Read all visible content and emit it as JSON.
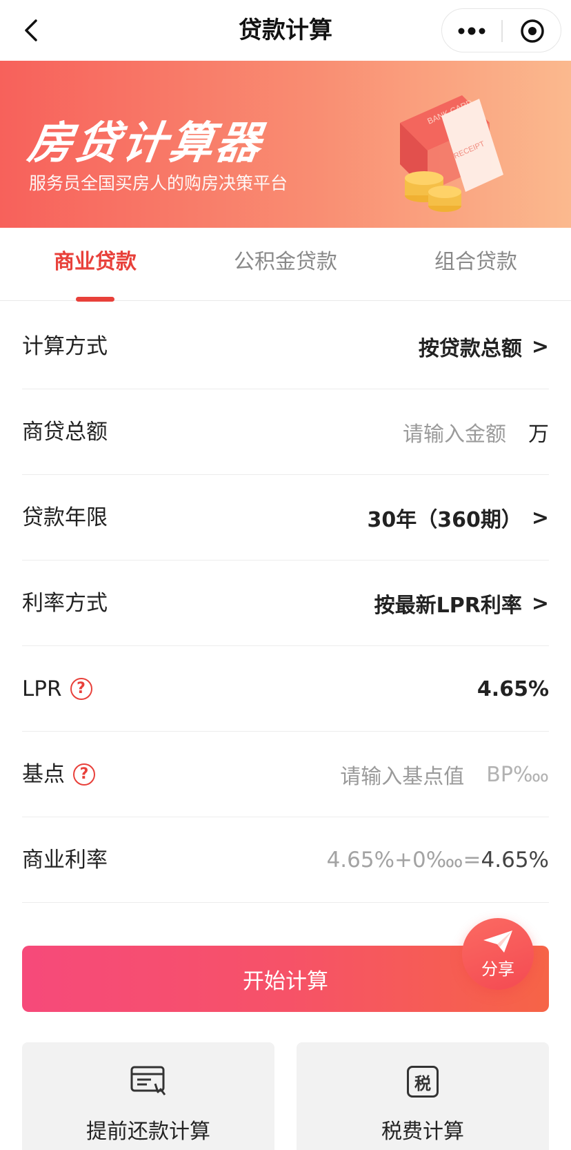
{
  "nav": {
    "title": "贷款计算"
  },
  "banner": {
    "title": "房贷计算器",
    "subtitle": "服务员全国买房人的购房决策平台",
    "illus_card_text": "BANK CARD",
    "illus_receipt_text": "RECEIPT"
  },
  "tabs": [
    {
      "label": "商业贷款",
      "active": true
    },
    {
      "label": "公积金贷款",
      "active": false
    },
    {
      "label": "组合贷款",
      "active": false
    }
  ],
  "form": {
    "calc_method": {
      "label": "计算方式",
      "value": "按贷款总额"
    },
    "loan_amount": {
      "label": "商贷总额",
      "placeholder": "请输入金额",
      "unit": "万"
    },
    "loan_term": {
      "label": "贷款年限",
      "value": "30年（360期）"
    },
    "rate_method": {
      "label": "利率方式",
      "value": "按最新LPR利率"
    },
    "lpr": {
      "label": "LPR",
      "help": "?",
      "value": "4.65%"
    },
    "basis_point": {
      "label": "基点",
      "help": "?",
      "placeholder": "请输入基点值",
      "unit": "BP‱"
    },
    "commercial_rate": {
      "label": "商业利率",
      "formula": "4.65%+0‱=",
      "result": "4.65%"
    },
    "chevron": ">"
  },
  "actions": {
    "calculate_label": "开始计算",
    "share_label": "分享"
  },
  "tools": [
    {
      "label": "提前还款计算",
      "icon": "prepayment-icon"
    },
    {
      "label": "税费计算",
      "icon": "tax-icon",
      "icon_text": "税"
    }
  ],
  "colors": {
    "accent": "#e8403a",
    "button_start": "#f64a7a",
    "button_end": "#f66447"
  }
}
